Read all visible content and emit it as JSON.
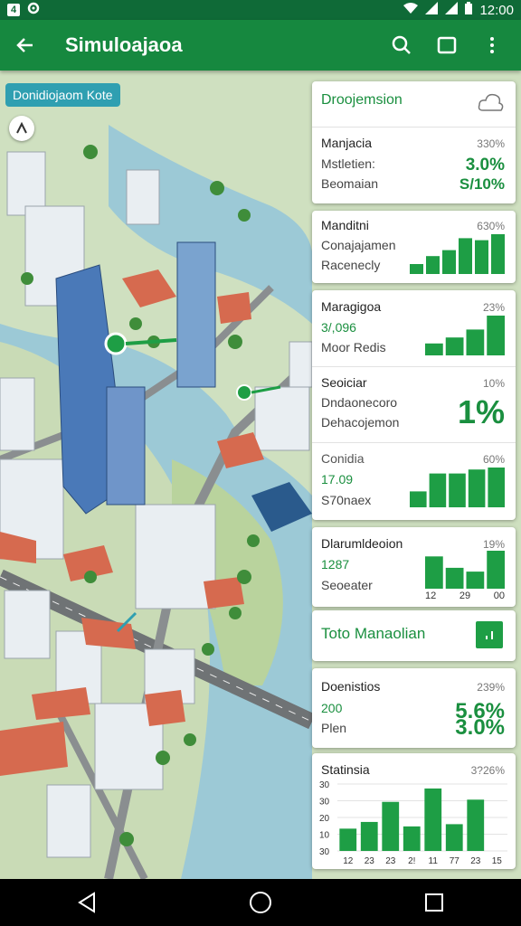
{
  "status": {
    "notif1": "4",
    "time": "12:00"
  },
  "app": {
    "title": "Simuloajaoa"
  },
  "map": {
    "label": "Donidiojaom Kote"
  },
  "panel1": {
    "title": "Droojemsion"
  },
  "card1": {
    "a": "Manjacia",
    "b": "Mstletien:",
    "c": "Beomaian",
    "pct": "330%",
    "v1": "3.0%",
    "v2": "S/10%"
  },
  "card2": {
    "a": "Manditni",
    "b": "Conajajamen",
    "c": "Racenecly",
    "pct": "630%",
    "bars": [
      0.25,
      0.45,
      0.6,
      0.9,
      0.85,
      1.0
    ]
  },
  "card3": {
    "a": "Maragigoa",
    "b": "3/,096",
    "c": "Moor Redis",
    "pct": "23%",
    "bars": [
      0.3,
      0.45,
      0.65,
      1.0
    ]
  },
  "card4": {
    "a": "Seoiciar",
    "b": "Dndaonecoro",
    "c": "Dehacojemon",
    "pct": "10%",
    "big": "1%"
  },
  "card5": {
    "a": "Conidia",
    "b": "17.09",
    "c": "S70naex",
    "pct": "60%",
    "bars": [
      0.4,
      0.85,
      0.85,
      0.95,
      1.0
    ]
  },
  "card6": {
    "a": "Dlarumldeoion",
    "b": "1287",
    "c": "Seoeater",
    "pct": "19%",
    "bars": [
      0.85,
      0.55,
      0.45,
      1.0
    ],
    "ticks": [
      "12",
      "29",
      "00"
    ]
  },
  "card7": {
    "title": "Toto Manaolian"
  },
  "card8": {
    "a": "Doenistios",
    "b": "200",
    "c": "Plen",
    "pct": "239%",
    "v1": "5.6%",
    "v2": "3.0%"
  },
  "card9": {
    "title": "Statinsia",
    "pct": "3?26%"
  },
  "chart_data": {
    "type": "bar",
    "title": "Statinsia",
    "categories": [
      "12",
      "23",
      "23",
      "2!",
      "11",
      "77",
      "23",
      "15"
    ],
    "values": [
      10,
      13,
      22,
      11,
      28,
      12,
      23,
      0
    ],
    "yticks": [
      "30",
      "30",
      "20",
      "10",
      "30"
    ],
    "ylim": [
      0,
      30
    ]
  },
  "colors": {
    "appbar": "#16883f",
    "statusbar": "#0f6a37",
    "accent": "#1e9e45",
    "label": "#2f9fb1"
  }
}
